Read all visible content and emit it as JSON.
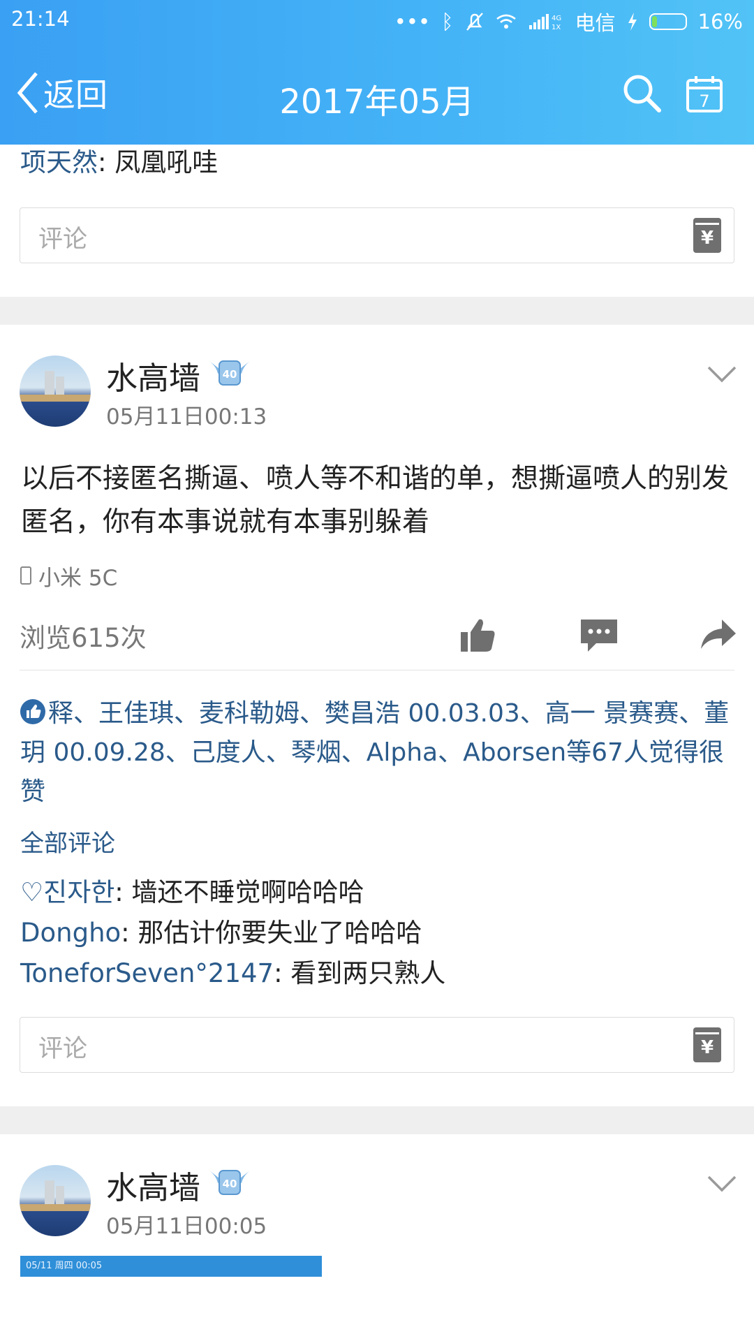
{
  "status_bar": {
    "time": "21:14",
    "carrier": "电信",
    "battery_pct": "16%",
    "battery_level": 0.16
  },
  "nav": {
    "back_label": "返回",
    "title": "2017年05月",
    "calendar_day": "7"
  },
  "prev_post": {
    "comments": [
      {
        "author": "项天然",
        "sep": ": ",
        "text": "凤凰吼哇"
      }
    ],
    "comment_placeholder": "评论"
  },
  "gift_symbol": "¥",
  "post1": {
    "author": "水高墙",
    "badge_text": "40",
    "time": "05月11日00:13",
    "text": "以后不接匿名撕逼、喷人等不和谐的单，想撕逼喷人的别发匿名，你有本事说就有本事别躲着",
    "device": "小米 5C",
    "views": "浏览615次",
    "likes_text": "释、王佳琪、麦科勒姆、樊昌浩 00.03.03、高一 景赛赛、董玥 00.09.28、己度人、琴烟、Alpha、Aborsen等67人觉得很赞",
    "all_comments_label": "全部评论",
    "comments": [
      {
        "author": "♡진자한",
        "sep": ": ",
        "text": "墙还不睡觉啊哈哈哈"
      },
      {
        "author": "Dongho",
        "sep": ": ",
        "text": "那估计你要失业了哈哈哈"
      },
      {
        "author": "ToneforSeven°2147",
        "sep": ": ",
        "text": "看到两只熟人"
      }
    ],
    "comment_placeholder": "评论"
  },
  "post2": {
    "author": "水高墙",
    "badge_text": "40",
    "time": "05月11日00:05",
    "image_status_text": "05/11 周四 00:05"
  },
  "colors": {
    "header_start": "#3aa0f3",
    "header_end": "#52c3f6",
    "link": "#2a5a8a"
  }
}
